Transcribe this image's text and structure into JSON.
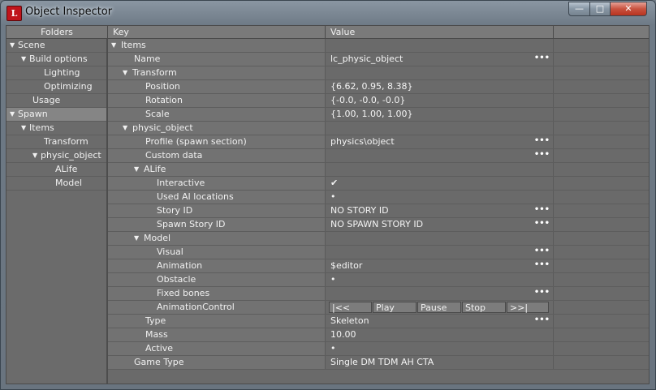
{
  "window": {
    "title": "Object Inspector",
    "app_icon_text": "L"
  },
  "titlebar_buttons": {
    "minimize": "—",
    "maximize": "□",
    "close": "✕"
  },
  "headers": {
    "folders": "Folders",
    "key": "Key",
    "value": "Value"
  },
  "folders": [
    {
      "label": "Scene",
      "expanded": true
    },
    {
      "label": "Build options",
      "expanded": true
    },
    {
      "label": "Lighting"
    },
    {
      "label": "Optimizing"
    },
    {
      "label": "Usage"
    },
    {
      "label": "Spawn",
      "expanded": true,
      "selected": true
    },
    {
      "label": "Items",
      "expanded": true
    },
    {
      "label": "Transform"
    },
    {
      "label": "physic_object",
      "expanded": true
    },
    {
      "label": "ALife"
    },
    {
      "label": "Model"
    }
  ],
  "props": [
    {
      "key": "Items",
      "value": ""
    },
    {
      "key": "Name",
      "value": "lc_physic_object",
      "dots": "•••"
    },
    {
      "key": "Transform",
      "value": ""
    },
    {
      "key": "Position",
      "value": "{6.62, 0.95, 8.38}"
    },
    {
      "key": "Rotation",
      "value": "{-0.0, -0.0, -0.0}"
    },
    {
      "key": "Scale",
      "value": "{1.00, 1.00, 1.00}"
    },
    {
      "key": "physic_object",
      "value": ""
    },
    {
      "key": "Profile (spawn section)",
      "value": "physics\\object",
      "dots": "•••"
    },
    {
      "key": "Custom data",
      "value": "",
      "dots": "•••"
    },
    {
      "key": "ALife",
      "value": ""
    },
    {
      "key": "Interactive",
      "value": "✔"
    },
    {
      "key": "Used AI locations",
      "value": "•"
    },
    {
      "key": "Story ID",
      "value": "NO STORY ID",
      "dots": "•••"
    },
    {
      "key": "Spawn Story ID",
      "value": "NO SPAWN STORY ID",
      "dots": "•••"
    },
    {
      "key": "Model",
      "value": ""
    },
    {
      "key": "Visual",
      "value": "",
      "dots": "•••"
    },
    {
      "key": "Animation",
      "value": "$editor",
      "dots": "•••"
    },
    {
      "key": "Obstacle",
      "value": "•"
    },
    {
      "key": "Fixed bones",
      "value": "",
      "dots": "•••"
    },
    {
      "key": "AnimationControl",
      "value": ""
    },
    {
      "key": "Type",
      "value": "Skeleton",
      "dots": "•••"
    },
    {
      "key": "Mass",
      "value": "10.00"
    },
    {
      "key": "Active",
      "value": "•"
    },
    {
      "key": "Game Type",
      "value": "Single DM TDM AH CTA"
    }
  ],
  "animation_controls": [
    "|<<",
    "Play",
    "Pause",
    "Stop",
    ">>|"
  ]
}
